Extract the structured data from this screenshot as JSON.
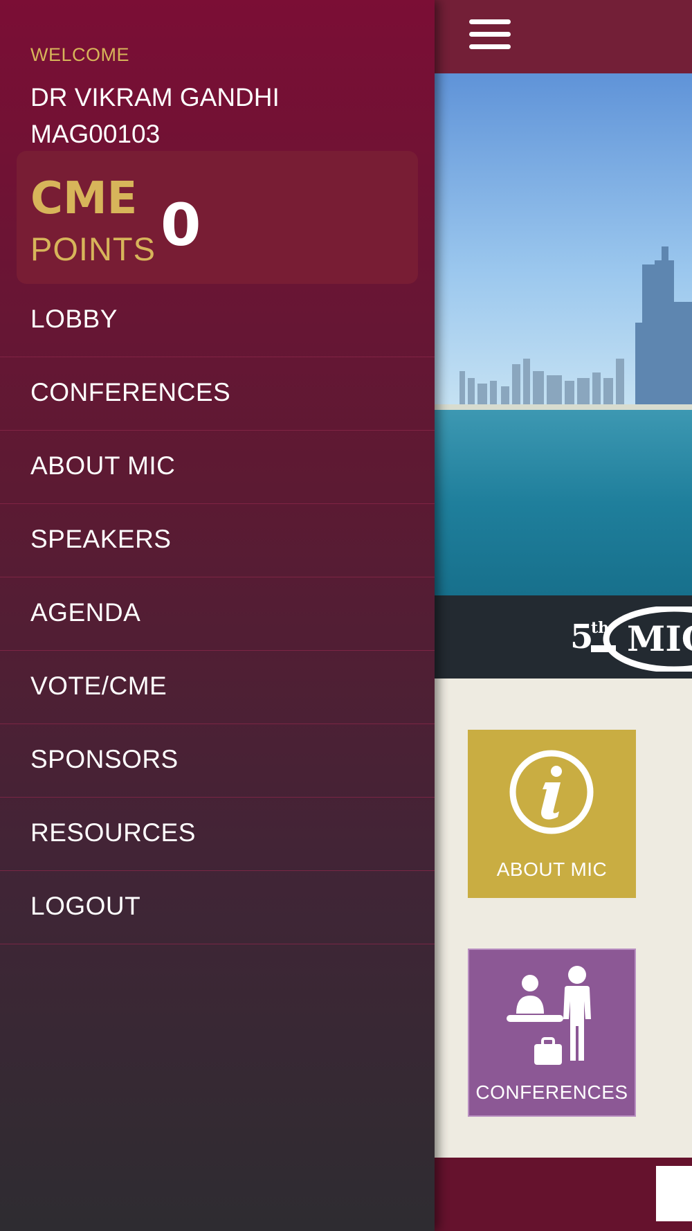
{
  "drawer": {
    "welcome": "WELCOME",
    "user_name": "DR VIKRAM GANDHI",
    "user_id": "MAG00103",
    "cme": {
      "label": "CME",
      "sublabel": "POINTS",
      "value": "0"
    },
    "menu": [
      {
        "label": "LOBBY"
      },
      {
        "label": "CONFERENCES"
      },
      {
        "label": "ABOUT MIC"
      },
      {
        "label": "SPEAKERS"
      },
      {
        "label": "AGENDA"
      },
      {
        "label": "VOTE/CME"
      },
      {
        "label": "SPONSORS"
      },
      {
        "label": "RESOURCES"
      },
      {
        "label": "LOGOUT"
      }
    ]
  },
  "app": {
    "banner_prefix": "5",
    "banner_suffix": "th",
    "banner_text": "MIC",
    "tiles": [
      {
        "label": "ABOUT MIC",
        "icon": "info-icon",
        "color": "#c9ad42"
      },
      {
        "label": "CONFERENCES",
        "icon": "reception-icon",
        "color": "#8c5895"
      }
    ]
  },
  "colors": {
    "brand_maroon": "#731f37",
    "gold": "#d7b55a",
    "banner_dark": "#232a31",
    "content_bg": "#eeebe1"
  }
}
